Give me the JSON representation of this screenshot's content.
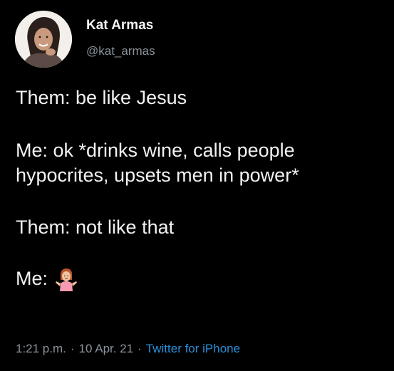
{
  "author": {
    "display_name": "Kat Armas",
    "handle": "@kat_armas"
  },
  "tweet": {
    "line1": "Them: be like Jesus",
    "line2": "Me: ok *drinks wine, calls people hypocrites, upsets men in power*",
    "line3": "Them: not like that",
    "line4": "Me:",
    "emoji_icon": "person-shrugging-icon"
  },
  "meta": {
    "time": "1:21 p.m.",
    "separator": "·",
    "date": "10 Apr. 21",
    "source": "Twitter for iPhone"
  },
  "colors": {
    "background": "#000000",
    "text": "#f2f2f2",
    "secondary": "#8b949b",
    "link": "#2a8fd8"
  }
}
